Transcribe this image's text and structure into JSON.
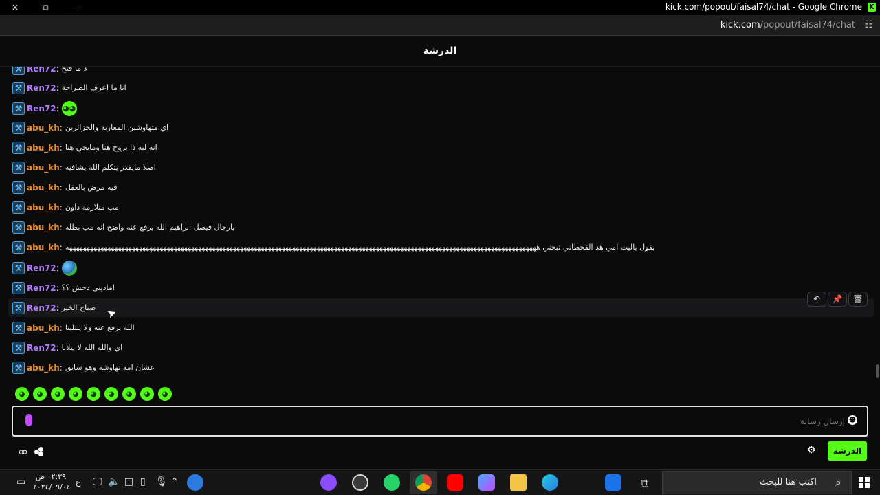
{
  "window": {
    "title": "kick.com/popout/faisal74/chat - Google Chrome",
    "close_icon": "×",
    "restore_icon": "⧉",
    "minimize_icon": "—"
  },
  "urlbar": {
    "host": "kick.com",
    "path": "/popout/faisal74/chat"
  },
  "chat": {
    "header": "الدرشة",
    "messages": [
      {
        "user": "Ren72",
        "type": "text",
        "text": "لا ما فتح"
      },
      {
        "user": "Ren72",
        "type": "text",
        "text": "انا ما اعرف الصراحة"
      },
      {
        "user": "Ren72",
        "type": "emote",
        "text": ""
      },
      {
        "user": "abu_kh",
        "type": "text",
        "text": "اي متهاوشين المغاربة والجزائرين"
      },
      {
        "user": "abu_kh",
        "type": "text",
        "text": "انه ليه ذا يروح هنا ومايجي هنا"
      },
      {
        "user": "abu_kh",
        "type": "text",
        "text": "اصلا مايقدر يتكلم الله يشافيه"
      },
      {
        "user": "abu_kh",
        "type": "text",
        "text": "فيه مرض بالعقل"
      },
      {
        "user": "abu_kh",
        "type": "text",
        "text": "مب متلازمة داون"
      },
      {
        "user": "abu_kh",
        "type": "text",
        "text": "يارجال فيصل ابراهيم الله يرفع عنه واضح انه مب بطله"
      },
      {
        "user": "abu_kh",
        "type": "text",
        "text": "يقول ياليت امي هذ القحطاني تبحني هههههههههههههههههههههههههههههههههههههههههههههههههههههههههههههههههههههههههههههههههههههههههههههههههههههههههههههههههههههههههههههههههههههههه"
      },
      {
        "user": "Ren72",
        "type": "emote-globe",
        "text": ""
      },
      {
        "user": "Ren72",
        "type": "text",
        "text": "امادينى دحش ؟؟"
      },
      {
        "user": "Ren72",
        "type": "text",
        "text": "صباح الخير"
      },
      {
        "user": "abu_kh",
        "type": "text",
        "text": "الله يرفع عنه ولا يبتلينا"
      },
      {
        "user": "Ren72",
        "type": "text",
        "text": "اي والله الله لا يبلانا"
      },
      {
        "user": "abu_kh",
        "type": "text",
        "text": "عشان امه تهاوشه وهو سايق"
      }
    ],
    "input_placeholder": "إرسال رسالة",
    "send_label": "الدرشة"
  },
  "taskbar": {
    "time": "٠٢:٣٩ ص",
    "date": "٢٠٢٤/٠٩/٠٤",
    "lang": "ع",
    "search_placeholder": "اكتب هنا للبحث"
  },
  "colors": {
    "accent": "#53fc18",
    "ren_color": "#b07bff",
    "abu_color": "#e68a2e"
  }
}
